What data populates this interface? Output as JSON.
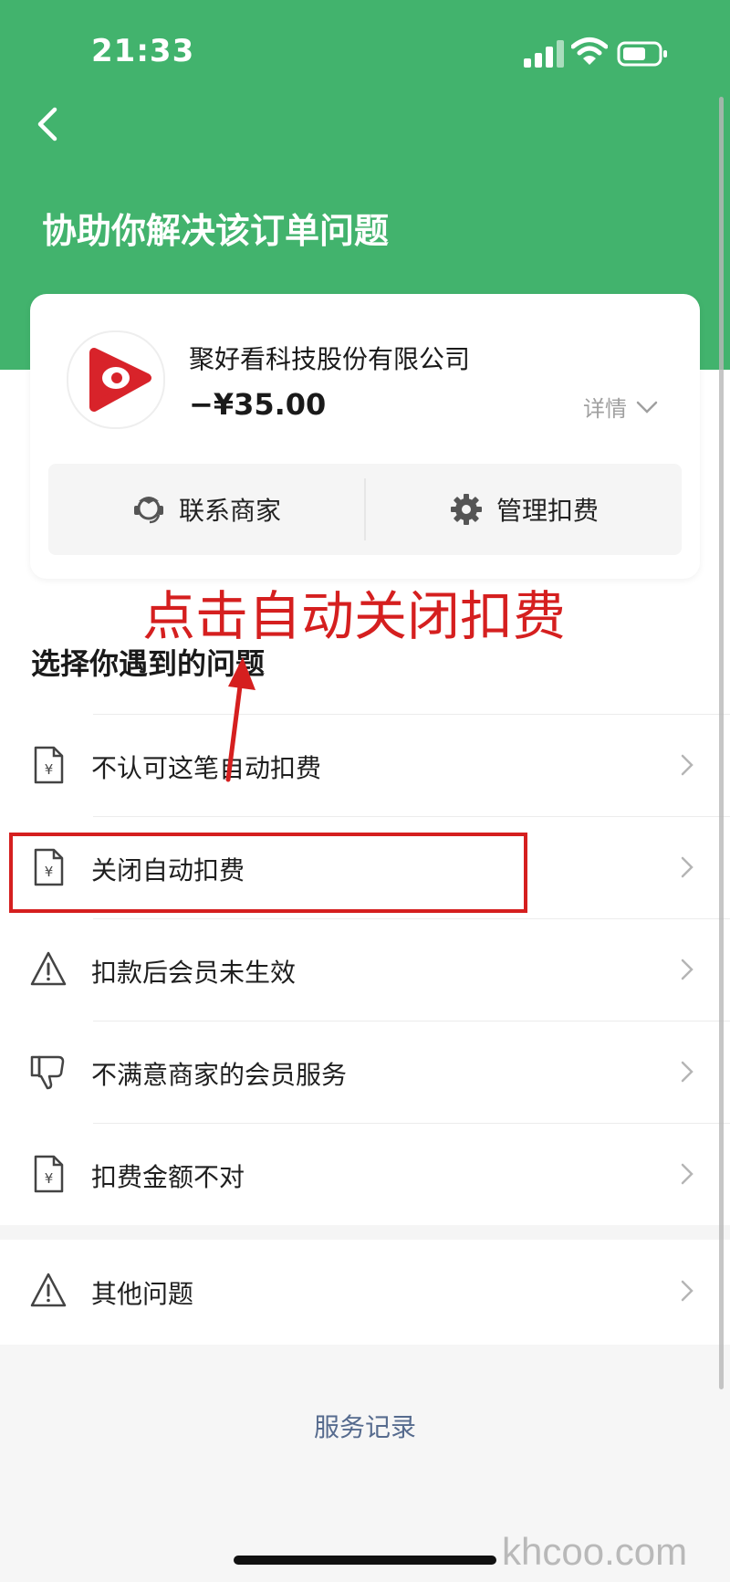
{
  "status_bar": {
    "time": "21:33"
  },
  "header": {
    "title": "协助你解决该订单问题"
  },
  "merchant": {
    "name": "聚好看科技股份有限公司",
    "amount": "−¥35.00",
    "detail_label": "详情",
    "actions": [
      {
        "label": "联系商家",
        "icon": "customer-service-icon"
      },
      {
        "label": "管理扣费",
        "icon": "gear-icon"
      }
    ]
  },
  "annotation": {
    "text": "点击自动关闭扣费"
  },
  "issues": {
    "section_title": "选择你遇到的问题",
    "items": [
      {
        "label": "不认可这笔自动扣费",
        "icon": "yuan-document-icon"
      },
      {
        "label": "关闭自动扣费",
        "icon": "yuan-document-icon"
      },
      {
        "label": "扣款后会员未生效",
        "icon": "warning-icon"
      },
      {
        "label": "不满意商家的会员服务",
        "icon": "thumbs-down-icon"
      },
      {
        "label": "扣费金额不对",
        "icon": "yuan-document-icon"
      }
    ],
    "other": {
      "label": "其他问题",
      "icon": "warning-icon"
    }
  },
  "footer": {
    "service_record": "服务记录"
  },
  "watermark": "khcoo.com",
  "colors": {
    "brand_green": "#42b36d",
    "annotation_red": "#d51f1f",
    "link_blue": "#566b8e"
  }
}
